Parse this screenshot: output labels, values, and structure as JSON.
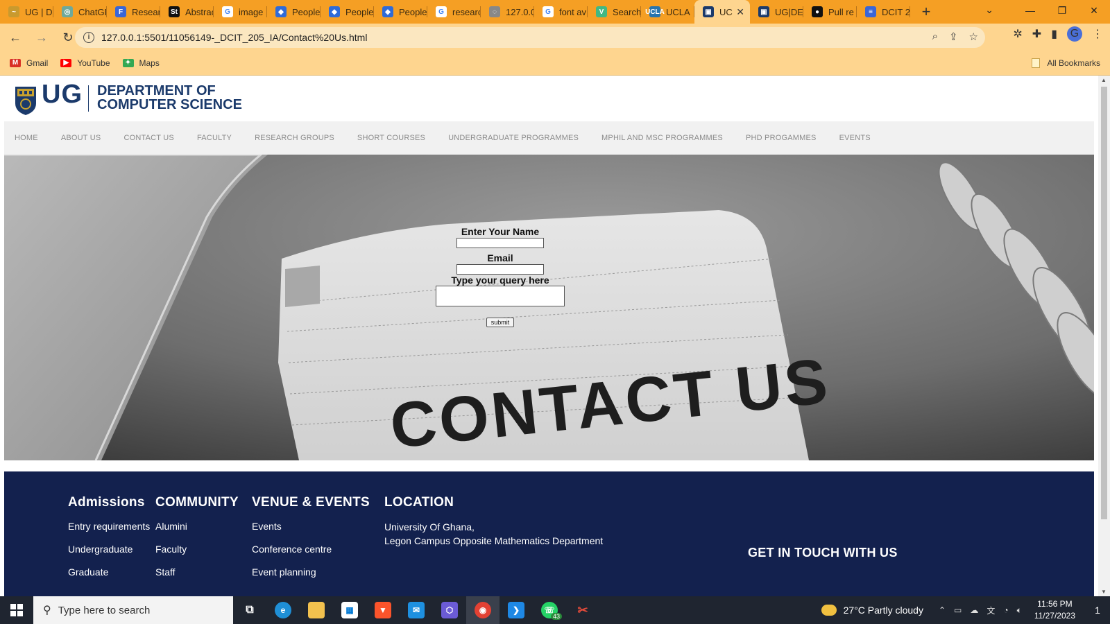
{
  "browser": {
    "tabs": [
      {
        "label": "UG | D",
        "color": "#c99a2e",
        "glyph": "~"
      },
      {
        "label": "ChatGP",
        "color": "#6ea99b",
        "glyph": "◎"
      },
      {
        "label": "Researc",
        "color": "#3a66d6",
        "glyph": "F"
      },
      {
        "label": "Abstrac",
        "color": "#111111",
        "glyph": "St"
      },
      {
        "label": "image",
        "color": "#ffffff",
        "glyph": "G"
      },
      {
        "label": "People",
        "color": "#2f6bd8",
        "glyph": "◆"
      },
      {
        "label": "People",
        "color": "#2f6bd8",
        "glyph": "◆"
      },
      {
        "label": "People",
        "color": "#2f6bd8",
        "glyph": "◆"
      },
      {
        "label": "researc",
        "color": "#ffffff",
        "glyph": "G"
      },
      {
        "label": "127.0.0",
        "color": "#888888",
        "glyph": "◌"
      },
      {
        "label": "font av",
        "color": "#ffffff",
        "glyph": "G"
      },
      {
        "label": "Search",
        "color": "#41b883",
        "glyph": "V"
      },
      {
        "label": "UCLA",
        "color": "#2774ae",
        "glyph": "UCLA"
      },
      {
        "label": "UC",
        "color": "#1b3a6b",
        "glyph": "▣",
        "active": true
      },
      {
        "label": "UG|DE",
        "color": "#1b3a6b",
        "glyph": "▣"
      },
      {
        "label": "Pull re",
        "color": "#111111",
        "glyph": "●"
      },
      {
        "label": "DCIT 2",
        "color": "#3a66d6",
        "glyph": "≡"
      }
    ],
    "url": "127.0.0.1:5501/11056149-_DCIT_205_IA/Contact%20Us.html",
    "bookmarks": [
      {
        "label": "Gmail",
        "color": "#d93025",
        "glyph": "M"
      },
      {
        "label": "YouTube",
        "color": "#ff0000",
        "glyph": "▶"
      },
      {
        "label": "Maps",
        "color": "#34a853",
        "glyph": "✦"
      }
    ],
    "all_bookmarks": "All Bookmarks",
    "profile_initial": "G"
  },
  "site": {
    "logo_text": "UG",
    "dept_line1": "DEPARTMENT OF",
    "dept_line2": "COMPUTER SCIENCE",
    "nav": [
      "HOME",
      "ABOUT US",
      "CONTACT US",
      "FACULTY",
      "RESEARCH GROUPS",
      "SHORT COURSES",
      "UNDERGRADUATE PROGRAMMES",
      "MPHIL AND MSC PROGRAMMES",
      "PHD PROGAMMES",
      "EVENTS"
    ],
    "hero_text": "CONTACT US",
    "form": {
      "name_label": "Enter Your Name",
      "email_label": "Email",
      "query_label": "Type your query here",
      "submit": "submit"
    },
    "footer": {
      "admissions": {
        "title": "Admissions",
        "links": [
          "Entry requirements",
          "Undergraduate",
          "Graduate"
        ]
      },
      "community": {
        "title": "COMMUNITY",
        "links": [
          "Alumini",
          "Faculty",
          "Staff"
        ]
      },
      "venue": {
        "title": "VENUE & EVENTS",
        "links": [
          "Events",
          "Conference centre",
          "Event planning"
        ]
      },
      "location": {
        "title": "LOCATION",
        "line1": "University Of Ghana,",
        "line2": "Legon Campus Opposite Mathematics Department"
      },
      "get_in_touch": "GET IN TOUCH WITH US"
    }
  },
  "taskbar": {
    "search_placeholder": "Type here to search",
    "weather": "27°C  Partly cloudy",
    "time": "11:56 PM",
    "date": "11/27/2023",
    "whatsapp_badge": "43",
    "notification_count": "1"
  }
}
